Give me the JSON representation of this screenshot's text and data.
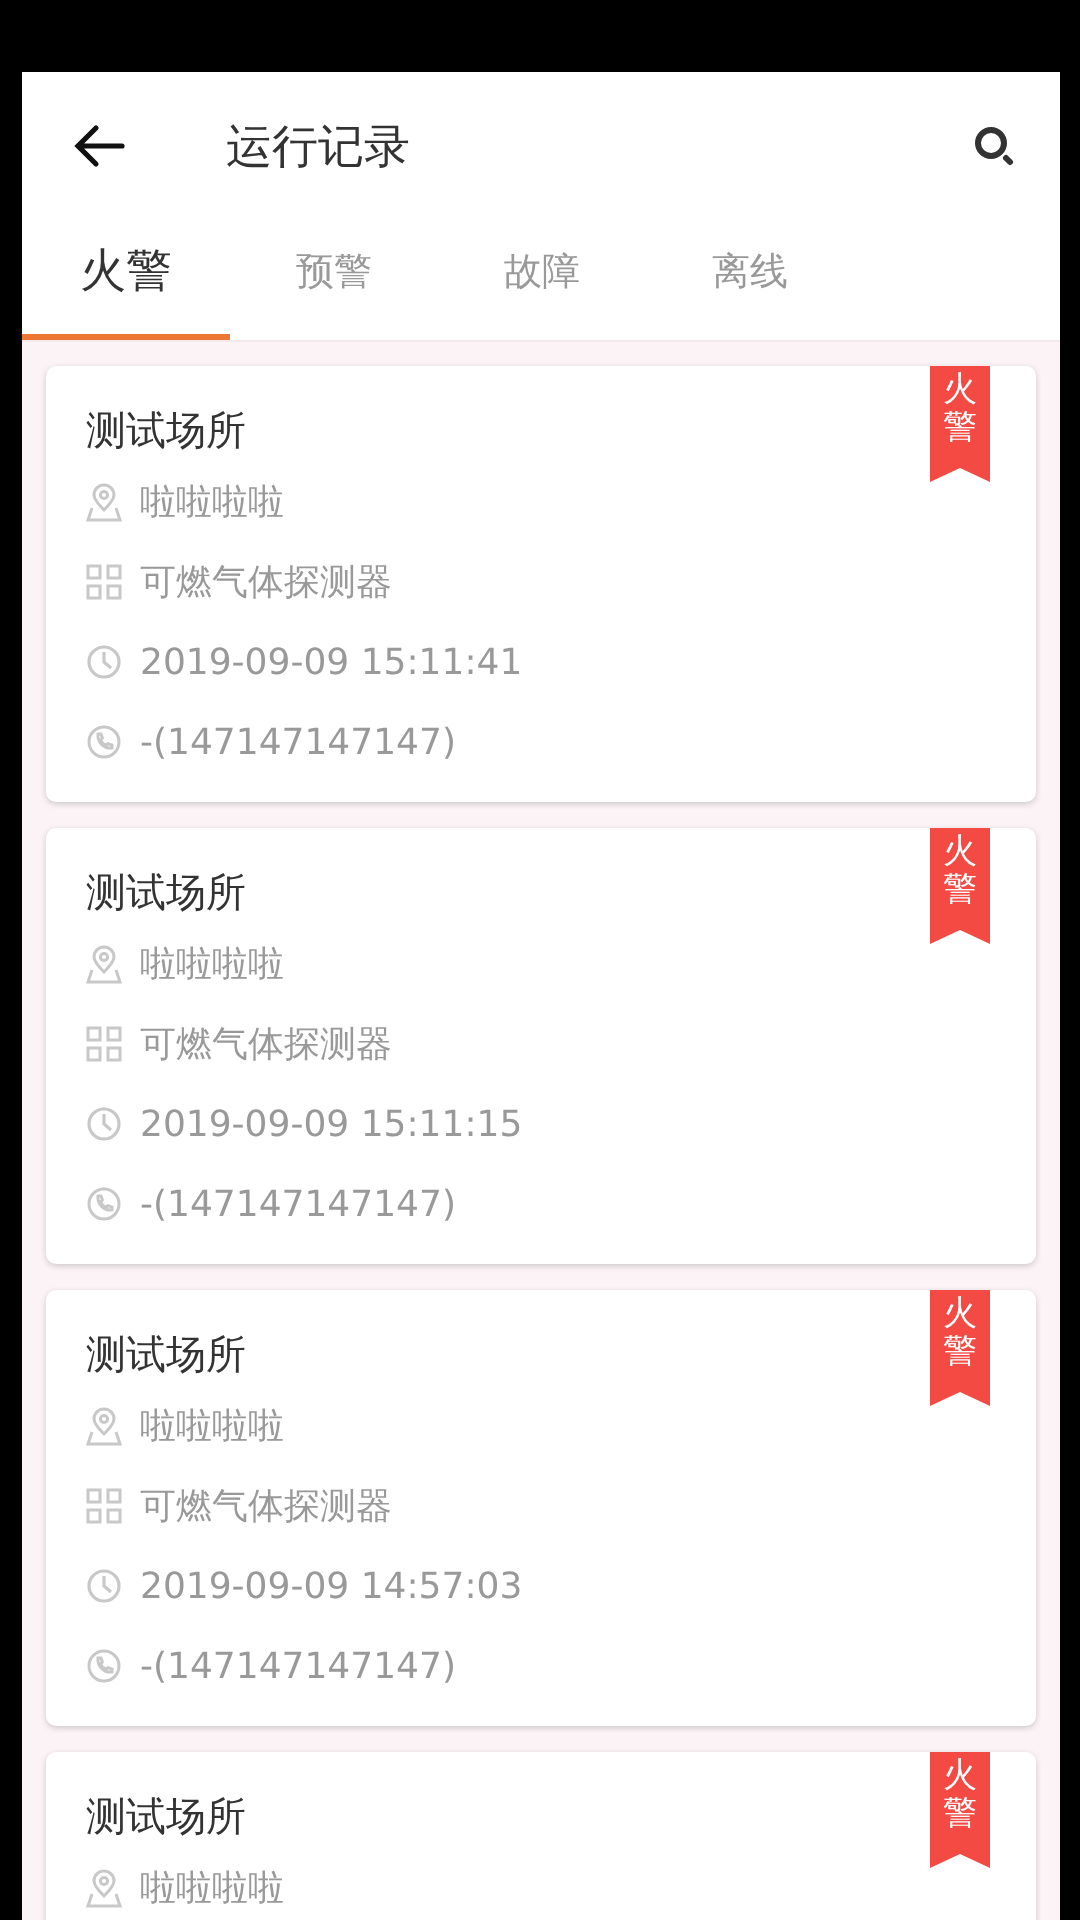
{
  "header": {
    "title": "运行记录"
  },
  "tabs": [
    {
      "label": "火警",
      "selected": true
    },
    {
      "label": "预警",
      "selected": false
    },
    {
      "label": "故障",
      "selected": false
    },
    {
      "label": "离线",
      "selected": false
    }
  ],
  "records": [
    {
      "name": "测试场所",
      "badge": "火警",
      "details": [
        {
          "kind": "location",
          "text": "啦啦啦啦"
        },
        {
          "kind": "device",
          "text": "可燃气体探测器"
        },
        {
          "kind": "time",
          "text": "2019-09-09 15:11:41"
        },
        {
          "kind": "phone",
          "text": "-(147147147147)"
        }
      ]
    },
    {
      "name": "测试场所",
      "badge": "火警",
      "details": [
        {
          "kind": "location",
          "text": "啦啦啦啦"
        },
        {
          "kind": "device",
          "text": "可燃气体探测器"
        },
        {
          "kind": "time",
          "text": "2019-09-09 15:11:15"
        },
        {
          "kind": "phone",
          "text": "-(147147147147)"
        }
      ]
    },
    {
      "name": "测试场所",
      "badge": "火警",
      "details": [
        {
          "kind": "location",
          "text": "啦啦啦啦"
        },
        {
          "kind": "device",
          "text": "可燃气体探测器"
        },
        {
          "kind": "time",
          "text": "2019-09-09 14:57:03"
        },
        {
          "kind": "phone",
          "text": "-(147147147147)"
        }
      ]
    },
    {
      "name": "测试场所",
      "badge": "火警",
      "details": [
        {
          "kind": "location",
          "text": "啦啦啦啦"
        }
      ]
    }
  ]
}
